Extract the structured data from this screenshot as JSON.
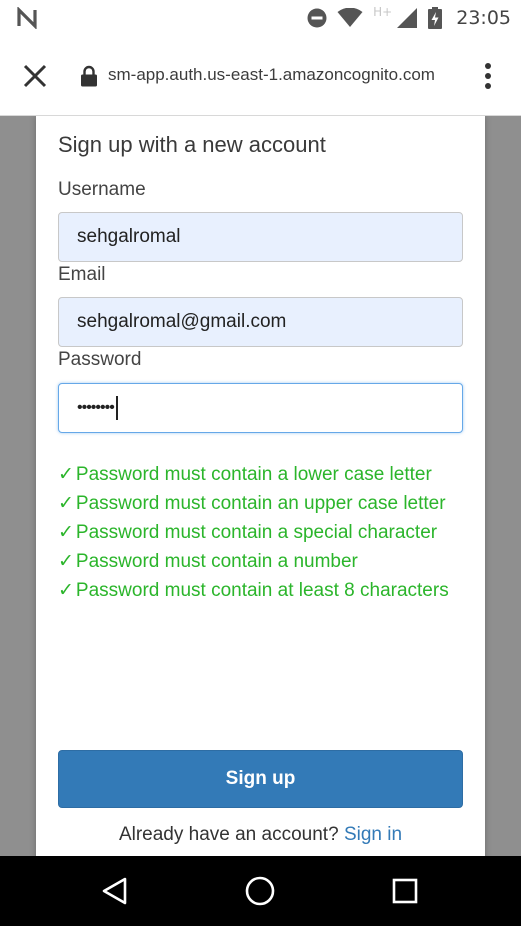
{
  "status_bar": {
    "time": "23:05",
    "network_label": "H+",
    "icons": [
      "notification-n-icon",
      "do-not-disturb-icon",
      "wifi-icon",
      "signal-icon",
      "battery-charging-icon"
    ]
  },
  "browser": {
    "url": "sm-app.auth.us-east-1.amazoncognito.com",
    "icons": [
      "close-icon",
      "lock-icon",
      "more-vert-icon"
    ]
  },
  "form": {
    "title": "Sign up with a new account",
    "username_label": "Username",
    "username_value": "sehgalromal",
    "email_label": "Email",
    "email_value": "sehgalromal@gmail.com",
    "password_label": "Password",
    "password_value": "••••••••",
    "check_mark": "✓",
    "requirements": [
      "Password must contain a lower case letter",
      "Password must contain an upper case letter",
      "Password must contain a special character",
      "Password must contain a number",
      "Password must contain at least 8 characters"
    ],
    "signup_label": "Sign up",
    "signin_prompt": "Already have an account?",
    "signin_link": "Sign in"
  },
  "colors": {
    "accent": "#337ab7",
    "success": "#2bb52b",
    "autofill_bg": "#e8f0fe"
  },
  "nav": {
    "icons": [
      "back-triangle-icon",
      "home-circle-icon",
      "recents-square-icon"
    ]
  }
}
